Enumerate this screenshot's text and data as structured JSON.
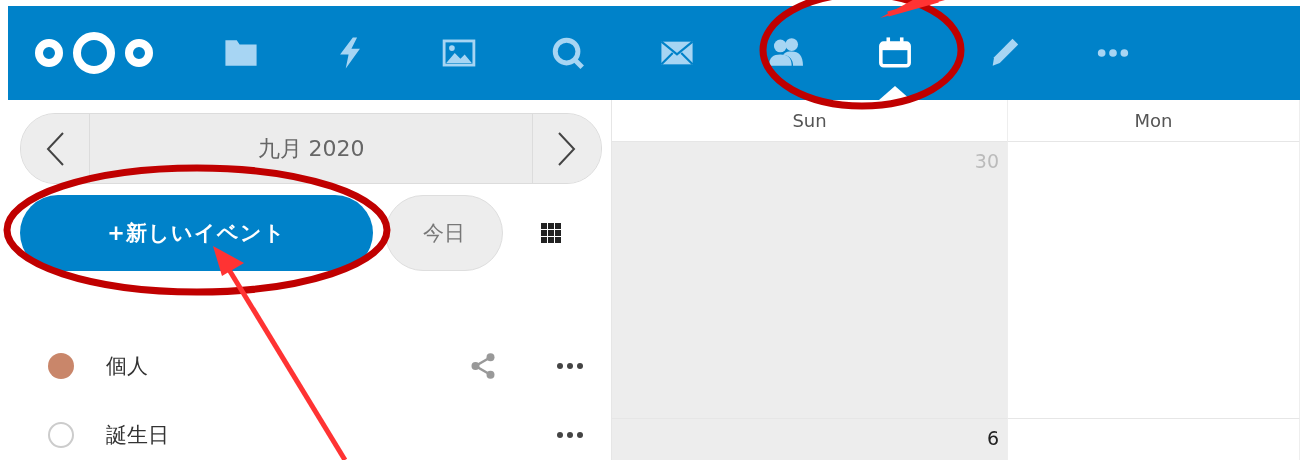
{
  "header": {
    "apps": [
      {
        "kind": "folder",
        "selected": false
      },
      {
        "kind": "bolt",
        "selected": false
      },
      {
        "kind": "image",
        "selected": false
      },
      {
        "kind": "search",
        "selected": false
      },
      {
        "kind": "mail",
        "selected": false
      },
      {
        "kind": "contacts",
        "selected": false
      },
      {
        "kind": "calendar",
        "selected": true
      },
      {
        "kind": "pencil",
        "selected": false
      },
      {
        "kind": "more",
        "selected": false
      }
    ]
  },
  "sidebar": {
    "date_picker": {
      "label": "九月 2020"
    },
    "new_event_button": "+新しいイベント",
    "today_button": "今日",
    "calendars": [
      {
        "name": "個人",
        "enabled": true,
        "color": "#c9866a",
        "shareable": true
      },
      {
        "name": "誕生日",
        "enabled": false,
        "shareable": false
      }
    ]
  },
  "calendar": {
    "columns": [
      {
        "label": "Sun",
        "weekend": true
      },
      {
        "label": "Mon",
        "weekend": false
      }
    ],
    "weeks": [
      {
        "sunday": {
          "number": "30",
          "outside_month": true
        }
      },
      {
        "sunday": {
          "number": "6",
          "outside_month": false
        }
      }
    ]
  },
  "annotations": [
    {
      "kind": "ellipse"
    },
    {
      "kind": "ellipse"
    },
    {
      "kind": "arrow"
    },
    {
      "kind": "arrow"
    }
  ]
}
